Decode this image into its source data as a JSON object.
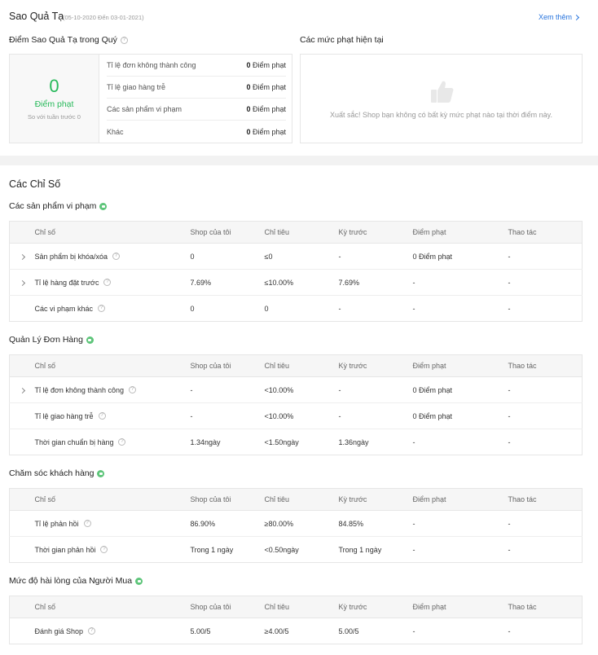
{
  "colors": {
    "accent_green": "#27b95a",
    "link_blue": "#2673dd"
  },
  "star": {
    "title": "Sao Quả Tạ",
    "date_range": "(05-10-2020 Đến 03-01-2021)",
    "see_more": "Xem thêm",
    "quarter_label": "Điểm Sao Quả Tạ trong Quý",
    "score": "0",
    "score_unit": "Điểm phạt",
    "compare": "So với tuần trước 0",
    "penalties": [
      {
        "label": "Tỉ lệ đơn không thành công",
        "value": "0",
        "unit": "Điểm phạt"
      },
      {
        "label": "Tỉ lệ giao hàng trễ",
        "value": "0",
        "unit": "Điểm phạt"
      },
      {
        "label": "Các sản phẩm vi phạm",
        "value": "0",
        "unit": "Điểm phạt"
      },
      {
        "label": "Khác",
        "value": "0",
        "unit": "Điểm phạt"
      }
    ],
    "current_label": "Các mức phạt hiện tại",
    "current_message": "Xuất sắc! Shop bạn không có bất kỳ mức phạt nào tại thời điểm này."
  },
  "metrics": {
    "title": "Các Chỉ Số",
    "columns": [
      "Chỉ số",
      "Shop của tôi",
      "Chỉ tiêu",
      "Kỳ trước",
      "Điểm phạt",
      "Thao tác"
    ],
    "sections": [
      {
        "title": "Các sản phẩm vi phạm",
        "rows": [
          {
            "name": "Sản phẩm bị khóa/xóa",
            "shop": "0",
            "target": "≤0",
            "prev": "-",
            "penalty": "0 Điểm phạt",
            "action": "-"
          },
          {
            "name": "Tỉ lệ hàng đặt trước",
            "shop": "7.69%",
            "target": "≤10.00%",
            "prev": "7.69%",
            "penalty": "-",
            "action": "-"
          },
          {
            "name": "Các vi phạm khác",
            "shop": "0",
            "target": "0",
            "prev": "-",
            "penalty": "-",
            "action": "-"
          }
        ]
      },
      {
        "title": "Quản Lý Đơn Hàng",
        "rows": [
          {
            "name": "Tỉ lệ đơn không thành công",
            "shop": "-",
            "target": "<10.00%",
            "prev": "-",
            "penalty": "0 Điểm phạt",
            "action": "-"
          },
          {
            "name": "Tỉ lệ giao hàng trễ",
            "shop": "-",
            "target": "<10.00%",
            "prev": "-",
            "penalty": "0 Điểm phạt",
            "action": "-"
          },
          {
            "name": "Thời gian chuẩn bị hàng",
            "shop": "1.34ngày",
            "target": "<1.50ngày",
            "prev": "1.36ngày",
            "penalty": "-",
            "action": "-"
          }
        ]
      },
      {
        "title": "Chăm sóc khách hàng",
        "rows": [
          {
            "name": "Tỉ lệ phản hồi",
            "shop": "86.90%",
            "target": "≥80.00%",
            "prev": "84.85%",
            "penalty": "-",
            "action": "-"
          },
          {
            "name": "Thời gian phản hồi",
            "shop": "Trong 1 ngày",
            "target": "<0.50ngày",
            "prev": "Trong 1 ngày",
            "penalty": "-",
            "action": "-"
          }
        ]
      },
      {
        "title": "Mức độ hài lòng của Người Mua",
        "rows": [
          {
            "name": "Đánh giá Shop",
            "shop": "5.00/5",
            "target": "≥4.00/5",
            "prev": "5.00/5",
            "penalty": "-",
            "action": "-"
          }
        ]
      }
    ]
  }
}
